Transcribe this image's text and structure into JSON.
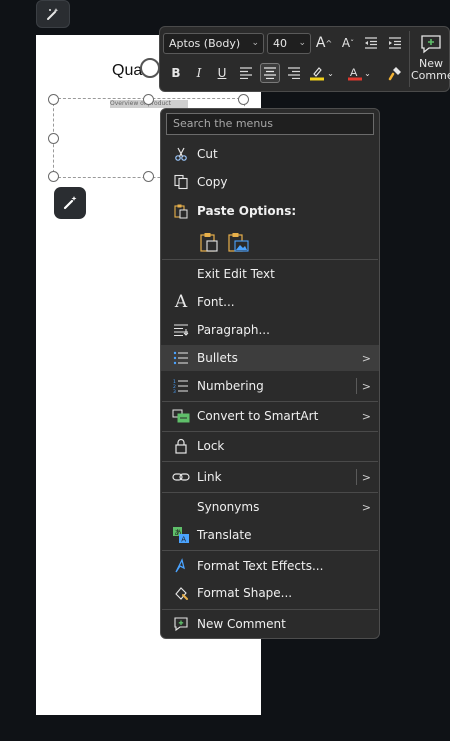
{
  "document": {
    "title_fragment": "Qua",
    "selection_tag": "Overview of product"
  },
  "toolbar": {
    "font_name": "Aptos (Body)",
    "font_size": "40",
    "increase_font": "A",
    "decrease_font": "A",
    "bold": "B",
    "italic": "I",
    "underline": "U",
    "new_comment_line1": "New",
    "new_comment_line2": "Comment",
    "highlight_color": "#f2d21b",
    "font_color": "#e03a2f"
  },
  "menu": {
    "search_placeholder": "Search the menus",
    "items": {
      "cut": "Cut",
      "copy": "Copy",
      "paste_options": "Paste Options:",
      "exit_edit_text": "Exit Edit Text",
      "font": "Font...",
      "paragraph": "Paragraph...",
      "bullets": "Bullets",
      "numbering": "Numbering",
      "convert_smartart": "Convert to SmartArt",
      "lock": "Lock",
      "link": "Link",
      "synonyms": "Synonyms",
      "translate": "Translate",
      "format_text_effects": "Format Text Effects...",
      "format_shape": "Format Shape...",
      "new_comment": "New Comment"
    },
    "submenu_arrow": ">"
  },
  "colors": {
    "accent_blue": "#4aa3ff",
    "accent_green": "#5fbf6a",
    "menu_bg": "#2b2b2b"
  }
}
